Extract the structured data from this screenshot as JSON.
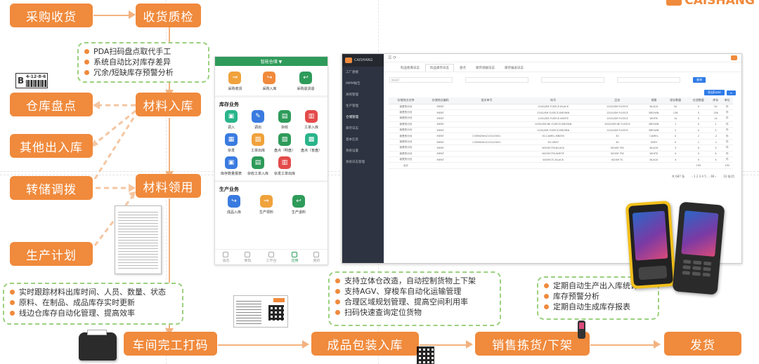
{
  "flow": {
    "purchase_receiving": "采购收货",
    "receiving_qc": "收货质检",
    "inventory_count": "仓库盘点",
    "material_inbound": "材料入库",
    "other_inbound": "其他出入库",
    "transfer": "转储调拨",
    "material_requisition": "材料领用",
    "production_plan": "生产计划",
    "workshop_print": "车间完工打码",
    "packaging_inbound": "成品包装入库",
    "picking_offshelf": "销售拣货/下架",
    "shipping": "发货"
  },
  "notes": {
    "pda": [
      "PDA扫码盘点取代手工",
      "系统自动比对库存差异",
      "冗余/短缺库存预警分析"
    ],
    "tracking": [
      "实时跟踪材料出库时间、人员、数量、状态",
      "原料、在制品、成品库存实时更新",
      "线边仓库存自动化管理、提高效率"
    ],
    "warehouse": [
      "支持立体仓改造，自动控制货物上下架",
      "支持AGV、穿梭车自动化运输管理",
      "合理区域规划管理、提高空间利用率",
      "扫码快速查询定位货物"
    ],
    "reports": [
      "定期自动生产出入库统计",
      "库存预警分析",
      "定期自动生成库存报表"
    ]
  },
  "label_tag": {
    "letter": "B",
    "code": "4-12-8-6"
  },
  "brand_partial": "CAISHANG",
  "phone_app": {
    "title": "智能仓储 ▼",
    "top_items": [
      "采购收货",
      "采购入库",
      "采购退货退"
    ],
    "section_inventory": "库存业务",
    "inventory_items": [
      "调入",
      "调出",
      "杂收",
      "工单入库",
      "杂发",
      "工单出库",
      "盘点（明盘）",
      "盘点（盲盘）",
      "库存数量报表",
      "杂收工单入库",
      "杂发工单出库"
    ],
    "section_production": "生产业务",
    "production_items": [
      "成品入库",
      "生产领料",
      "生产退料"
    ],
    "nav": [
      "消息",
      "审批",
      "工作台",
      "应用",
      "我的"
    ]
  },
  "desktop_app": {
    "logo": "CAISHANG",
    "menu": [
      "工厂建模",
      "IMPM报告",
      "采购管理",
      "生产管理",
      "仓储管理",
      "库存日志",
      "基本信息",
      "系统设置",
      "系统日志管理"
    ],
    "tabs": [
      "料品移库日志",
      "料品库存日志",
      "盘点",
      "库存调拨日志",
      "库存报表日志"
    ],
    "filter_value": "MENT",
    "search_button": "查询",
    "export_button": "导出Excel",
    "columns": [
      "存储地点名称",
      "存储地点编码",
      "批次单号",
      "料号",
      "品名",
      "规格",
      "现存数量",
      "在途数量",
      "库存",
      "单位"
    ],
    "rows": [
      [
        "我是的分仓",
        "MENT",
        "",
        "120G/SM-FLEECE-BLACK",
        "120G/SM FLEECE",
        "BLACK",
        "32",
        "0",
        "32",
        "件"
      ],
      [
        "我是的分仓",
        "MENT",
        "",
        "120G/SM-FLEECE-BROWN",
        "120G/SM FLEECE",
        "BROWN",
        "136",
        "0",
        "136",
        "件"
      ],
      [
        "我是的分仓",
        "MENT",
        "",
        "120G/SM-FLEECE-WHITE",
        "120G/SM FLEECE",
        "WHITE",
        "14",
        "0",
        "14",
        "件"
      ],
      [
        "我是的分仓",
        "MENT",
        "",
        "100G/SM-NE-FLEECE-BROWN",
        "100G/SM NE FLEECE",
        "BROWN",
        "1",
        "0",
        "1",
        "件"
      ],
      [
        "我是的分仓",
        "MENT",
        "",
        "120G/SM-FLEECE-BROWN",
        "120G/SM FLEECE",
        "BROWN",
        "2",
        "0",
        "2",
        "件"
      ],
      [
        "我是的分仓",
        "MENT",
        "COM0DHm210120001",
        "30-CAMEL-M6090",
        "30",
        "CAMEL",
        "0",
        "2",
        "-2",
        "件"
      ],
      [
        "我是的分仓",
        "MENT",
        "COM0DHm210120001",
        "30-GREY",
        "30",
        "GREY",
        "0",
        "1",
        "-1",
        "件"
      ],
      [
        "我是的分仓",
        "MENT",
        "",
        "W20M-TFA-BLACK",
        "W20M TFA",
        "BLACK",
        "3",
        "0",
        "3",
        "件"
      ],
      [
        "我是的分仓",
        "MENT",
        "",
        "W20M-TFA-WHITE",
        "W20M TFA",
        "WHITE",
        "4",
        "0",
        "4",
        "件"
      ],
      [
        "我是的分仓",
        "MENT",
        "",
        "W20M-TC-BLACK",
        "W20M TC",
        "BLACK",
        "3",
        "0",
        "3",
        "件"
      ]
    ],
    "total_label": "合计",
    "total_value": "195",
    "total_stock": "192",
    "pagination_total": "共 687 条",
    "page_size": "10 条/页"
  },
  "colors": {
    "orange": "#f08a3c",
    "green": "#9bd17f",
    "phone_header": "#2e9b5a",
    "sidebar": "#2d3340"
  }
}
